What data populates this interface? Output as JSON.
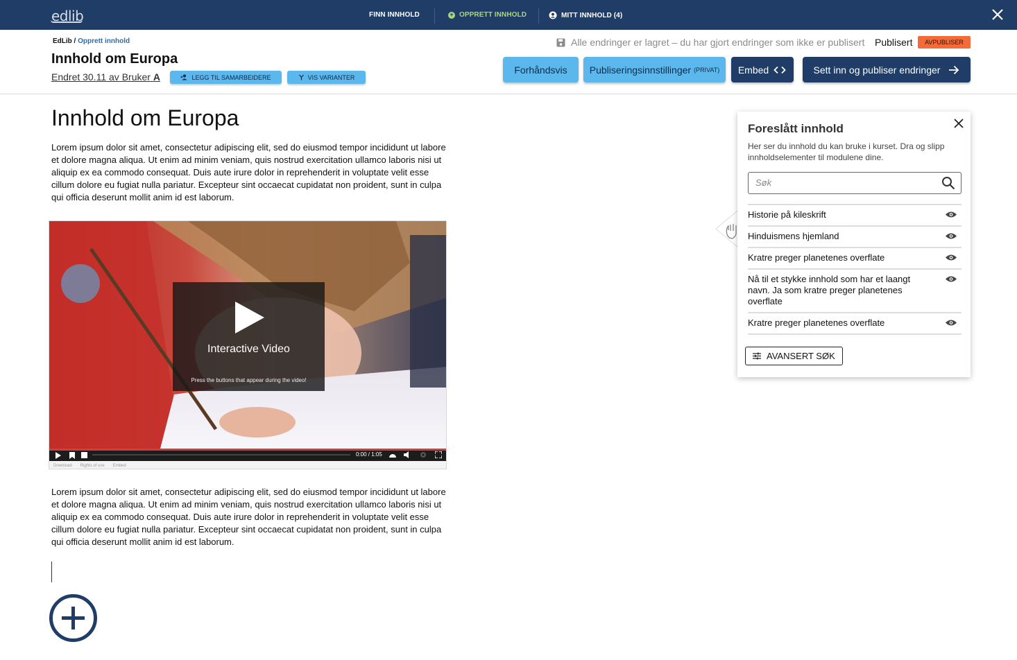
{
  "nav": {
    "logo": "edlib",
    "items": [
      {
        "label": "FINN INNHOLD"
      },
      {
        "label": "OPPRETT INNHOLD"
      },
      {
        "label": "MITT INNHOLD (4)"
      }
    ]
  },
  "header": {
    "breadcrumb_root": "EdLib /",
    "breadcrumb_current": "Opprett innhold",
    "title": "Innhold om Europa",
    "edited_prefix": "Endret 30.11 av Bruker",
    "edited_user_initial": "A",
    "add_collaborators_label": "LEGG TIL SAMARBEIDERE",
    "show_variants_label": "VIS VARIANTER",
    "save_status": "Alle endringer er lagret – du har gjort endringer som ikke er publisert",
    "published_label": "Publisert",
    "unpublish_label": "AVPUBLISER",
    "preview_label": "Forhåndsvis",
    "publish_settings_label": "Publiseringsinnstillinger",
    "publish_settings_tag": "(PRIVAT)",
    "embed_label": "Embed",
    "publish_changes_label": "Sett inn og publiser endringer"
  },
  "content": {
    "title": "Innhold om Europa",
    "paragraph1": "Lorem ipsum dolor sit amet, consectetur adipiscing elit, sed do eiusmod tempor incididunt ut labore et dolore magna aliqua. Ut enim ad minim veniam, quis nostrud exercitation ullamco laboris nisi ut aliquip ex ea commodo consequat. Duis aute irure dolor in reprehenderit in voluptate velit esse cillum dolore eu fugiat nulla pariatur. Excepteur sint occaecat cupidatat non proident, sunt in culpa qui officia deserunt mollit anim id est laborum.",
    "paragraph2": "Lorem ipsum dolor sit amet, consectetur adipiscing elit, sed do eiusmod tempor incididunt ut labore et dolore magna aliqua. Ut enim ad minim veniam, quis nostrud exercitation ullamco laboris nisi ut aliquip ex ea commodo consequat. Duis aute irure dolor in reprehenderit in voluptate velit esse cillum dolore eu fugiat nulla pariatur. Excepteur sint occaecat cupidatat non proident, sunt in culpa qui officia deserunt mollit anim id est laborum.",
    "video": {
      "title": "Interactive Video",
      "subtitle": "Press the buttons that appear during the video!",
      "time": "0:00 / 1:05",
      "footer_download": "Download",
      "footer_rights": "Rights of use",
      "footer_embed": "Embed"
    }
  },
  "panel": {
    "title": "Foreslått innhold",
    "description": "Her ser du innhold du kan bruke i kurset. Dra og slipp innholdselementer til modulene dine.",
    "search_placeholder": "Søk",
    "items": [
      {
        "label": "Historie på kileskrift"
      },
      {
        "label": "Hinduismens hjemland"
      },
      {
        "label": "Kratre preger planetenes overflate"
      },
      {
        "label": "Nå til et stykke innhold som har et laangt navn. Ja som kratre preger planetenes overflate"
      },
      {
        "label": "Kratre preger planetenes overflate"
      }
    ],
    "advanced_search_label": "AVANSERT SØK"
  },
  "colors": {
    "nav_bg": "#1f3d66",
    "accent_light": "#5cb8ec",
    "accent_green": "#a9d87a",
    "unpublish": "#f26b38"
  }
}
